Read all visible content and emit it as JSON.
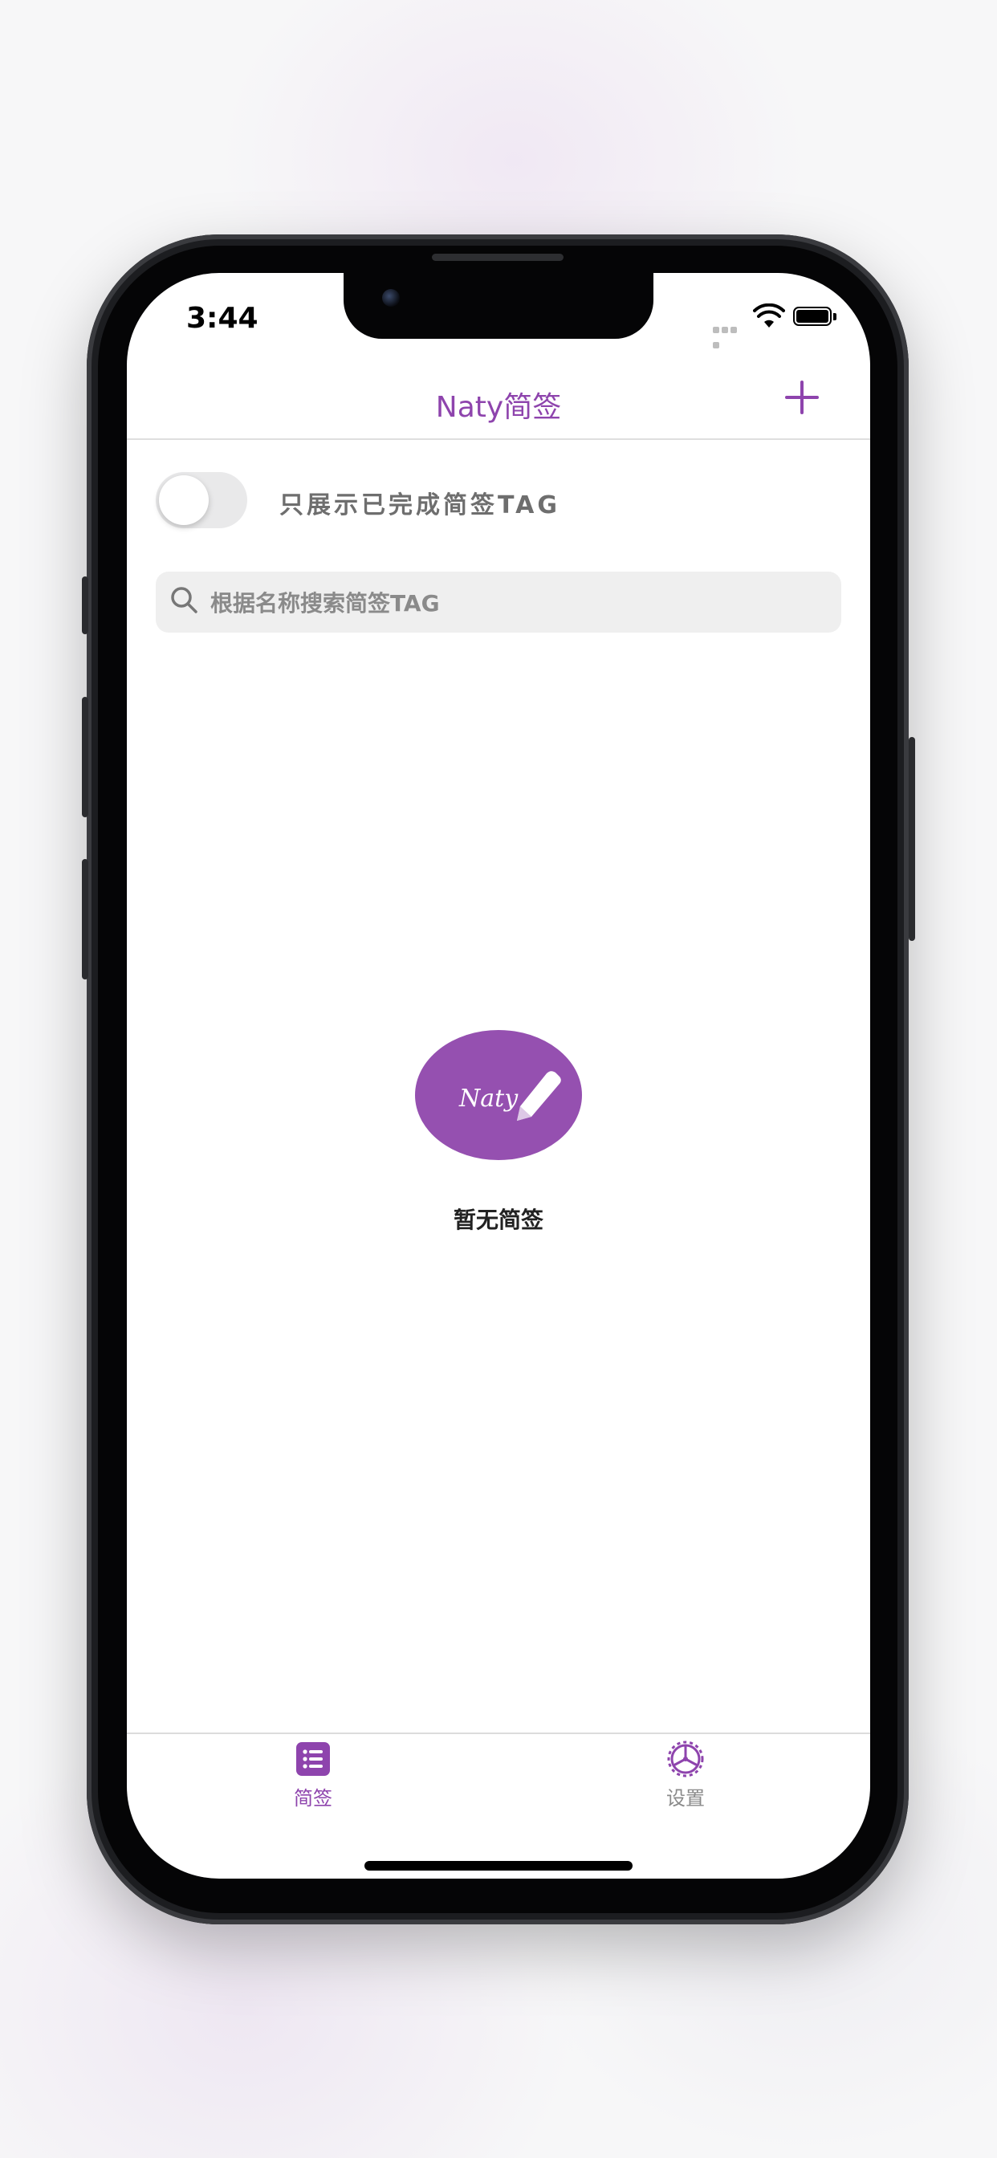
{
  "status_bar": {
    "time": "3:44"
  },
  "nav": {
    "title": "Naty简签",
    "add_icon": "plus-icon"
  },
  "filter": {
    "toggle_label": "只展示已完成简签TAG",
    "toggle_on": false
  },
  "search": {
    "placeholder": "根据名称搜索简签TAG",
    "value": "",
    "icon": "search-icon"
  },
  "empty_state": {
    "logo_text": "Naty",
    "message": "暂无简签"
  },
  "tabs": [
    {
      "label": "简签",
      "icon": "list-icon",
      "active": true
    },
    {
      "label": "设置",
      "icon": "settings-icon",
      "active": false
    }
  ],
  "colors": {
    "accent": "#8e44ad",
    "inactive": "#8a8a8a",
    "toggle_off": "#e9e9ea"
  }
}
